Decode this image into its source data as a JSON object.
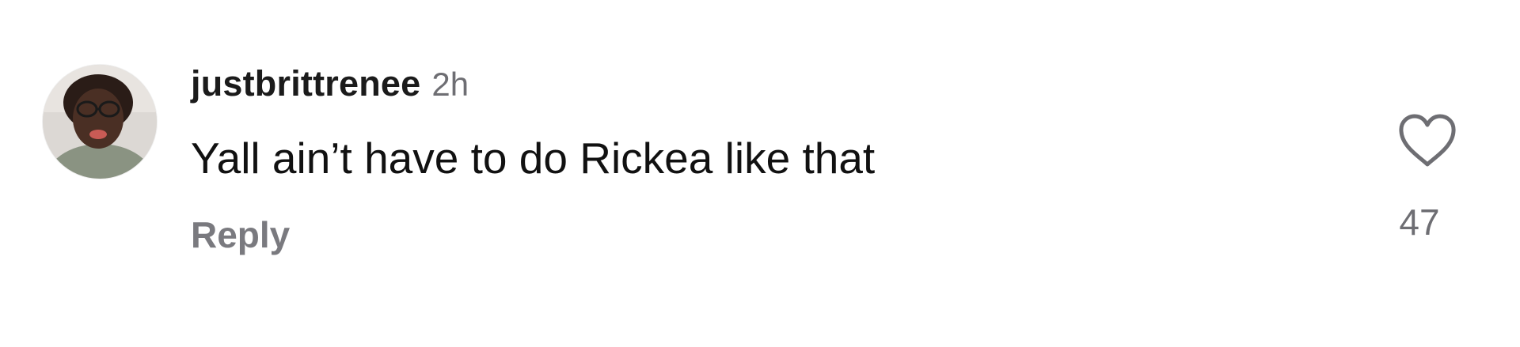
{
  "comment": {
    "username": "justbrittrenee",
    "timestamp": "2h",
    "text": "Yall ain’t have to do Rickea like that",
    "reply_label": "Reply",
    "like_count": "47",
    "avatar_icon": "user-avatar-photo",
    "like_icon": "heart-outline-icon"
  },
  "colors": {
    "text": "#111111",
    "secondary": "#6e6e73",
    "reply": "#7a7a7f",
    "background": "#ffffff"
  }
}
